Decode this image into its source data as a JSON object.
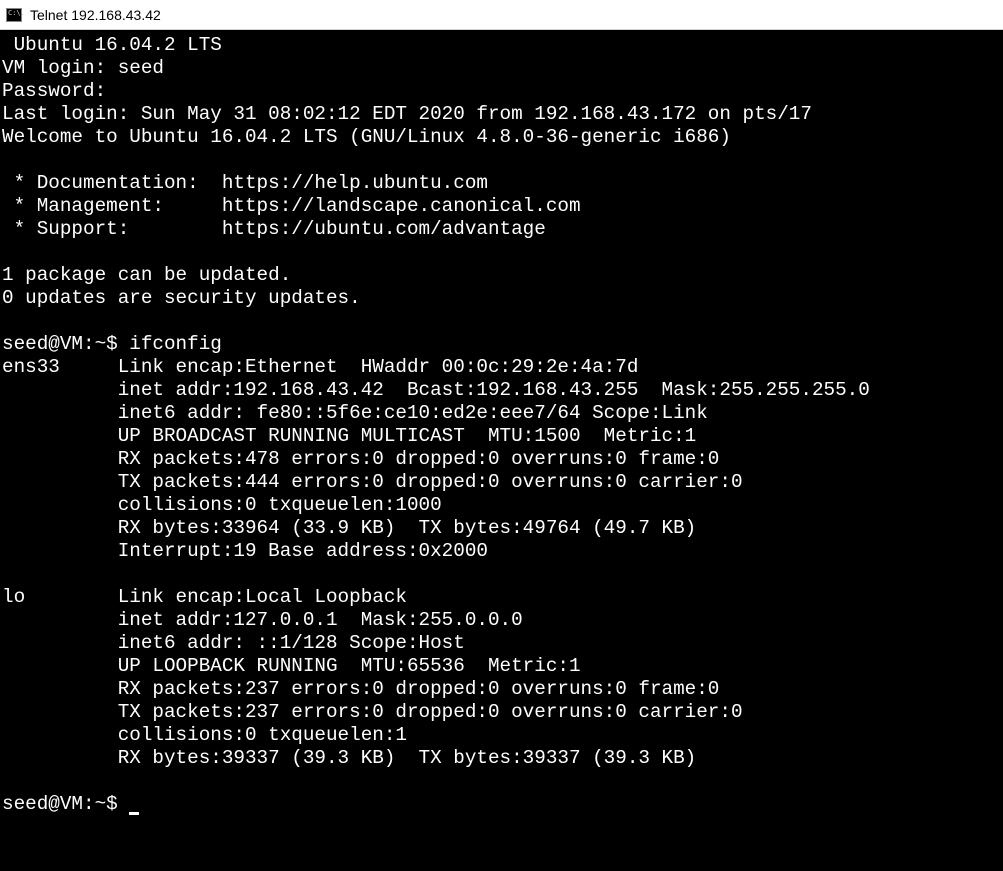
{
  "window": {
    "title": "Telnet 192.168.43.42"
  },
  "terminal": {
    "lines": [
      " Ubuntu 16.04.2 LTS",
      "VM login: seed",
      "Password:",
      "Last login: Sun May 31 08:02:12 EDT 2020 from 192.168.43.172 on pts/17",
      "Welcome to Ubuntu 16.04.2 LTS (GNU/Linux 4.8.0-36-generic i686)",
      "",
      " * Documentation:  https://help.ubuntu.com",
      " * Management:     https://landscape.canonical.com",
      " * Support:        https://ubuntu.com/advantage",
      "",
      "1 package can be updated.",
      "0 updates are security updates.",
      "",
      "seed@VM:~$ ifconfig",
      "ens33     Link encap:Ethernet  HWaddr 00:0c:29:2e:4a:7d",
      "          inet addr:192.168.43.42  Bcast:192.168.43.255  Mask:255.255.255.0",
      "          inet6 addr: fe80::5f6e:ce10:ed2e:eee7/64 Scope:Link",
      "          UP BROADCAST RUNNING MULTICAST  MTU:1500  Metric:1",
      "          RX packets:478 errors:0 dropped:0 overruns:0 frame:0",
      "          TX packets:444 errors:0 dropped:0 overruns:0 carrier:0",
      "          collisions:0 txqueuelen:1000",
      "          RX bytes:33964 (33.9 KB)  TX bytes:49764 (49.7 KB)",
      "          Interrupt:19 Base address:0x2000",
      "",
      "lo        Link encap:Local Loopback",
      "          inet addr:127.0.0.1  Mask:255.0.0.0",
      "          inet6 addr: ::1/128 Scope:Host",
      "          UP LOOPBACK RUNNING  MTU:65536  Metric:1",
      "          RX packets:237 errors:0 dropped:0 overruns:0 frame:0",
      "          TX packets:237 errors:0 dropped:0 overruns:0 carrier:0",
      "          collisions:0 txqueuelen:1",
      "          RX bytes:39337 (39.3 KB)  TX bytes:39337 (39.3 KB)",
      "",
      "seed@VM:~$ "
    ]
  }
}
